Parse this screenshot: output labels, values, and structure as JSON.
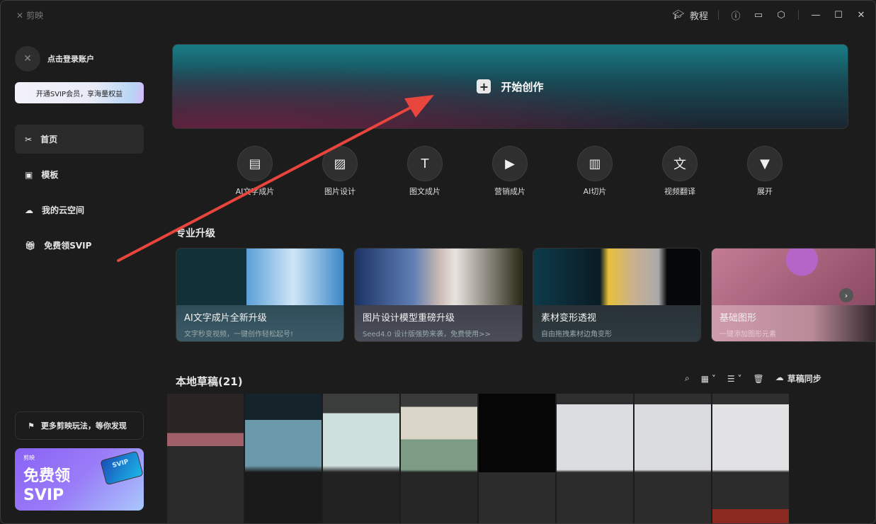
{
  "app": {
    "name": "剪映"
  },
  "titlebar": {
    "tutorial": "教程"
  },
  "sidebar": {
    "login": "点击登录账户",
    "vip_banner": "开通SVIP会员，享海量权益",
    "nav": [
      {
        "label": "首页",
        "icon": "scissors-icon"
      },
      {
        "label": "模板",
        "icon": "template-icon"
      },
      {
        "label": "我的云空间",
        "icon": "cloud-icon"
      },
      {
        "label": "免费领SVIP",
        "icon": "gift-icon"
      }
    ],
    "more": "更多剪映玩法，等你发现",
    "promo": {
      "logo": "剪映",
      "line1": "免费领",
      "line2": "SVIP",
      "card": "SVIP"
    }
  },
  "banner": {
    "label": "开始创作"
  },
  "shortcuts": [
    {
      "label": "AI文字成片"
    },
    {
      "label": "图片设计"
    },
    {
      "label": "图文成片"
    },
    {
      "label": "营销成片"
    },
    {
      "label": "AI切片"
    },
    {
      "label": "视频翻译"
    },
    {
      "label": "展开"
    }
  ],
  "upgrade": {
    "title": "专业升级",
    "cards": [
      {
        "title": "AI文字成片全新升级",
        "sub": "文字秒变视频，一键创作轻松起号!"
      },
      {
        "title": "图片设计模型重磅升级",
        "sub": "Seed4.0 设计版强势来袭，免费使用>>"
      },
      {
        "title": "素材变形透视",
        "sub": "自由拖拽素材边角变形"
      },
      {
        "title": "基础图形",
        "sub": "一键添加图形元素"
      }
    ]
  },
  "drafts": {
    "title": "本地草稿(21)",
    "sync": "草稿同步"
  },
  "colors": {
    "annotation": "#e8453c"
  }
}
